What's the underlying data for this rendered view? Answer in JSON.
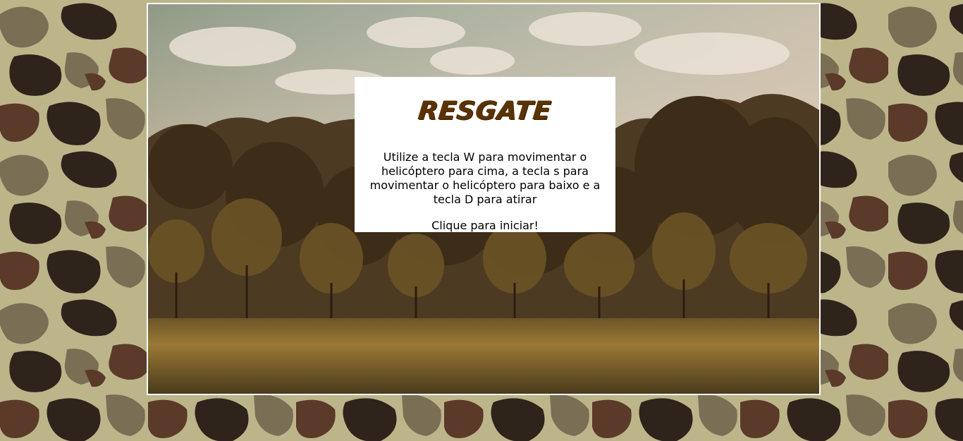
{
  "game": {
    "title": "RESGATE",
    "instructions": "Utilize a tecla W para movimentar o helicóptero para cima, a tecla s para movimentar o helicóptero para baixo e a tecla D para atirar",
    "start_prompt": "Clique para iniciar!"
  },
  "colors": {
    "title": "#5a3304",
    "panel_bg": "#ffffff",
    "frame_border": "#ffffff",
    "camo_light": "#bdb58a",
    "camo_mid": "#7a6f55",
    "camo_brown": "#5b3a2a",
    "camo_dark": "#2e241b"
  },
  "icons": {
    "background": "camouflage-pattern",
    "scene": "forest-landscape"
  }
}
